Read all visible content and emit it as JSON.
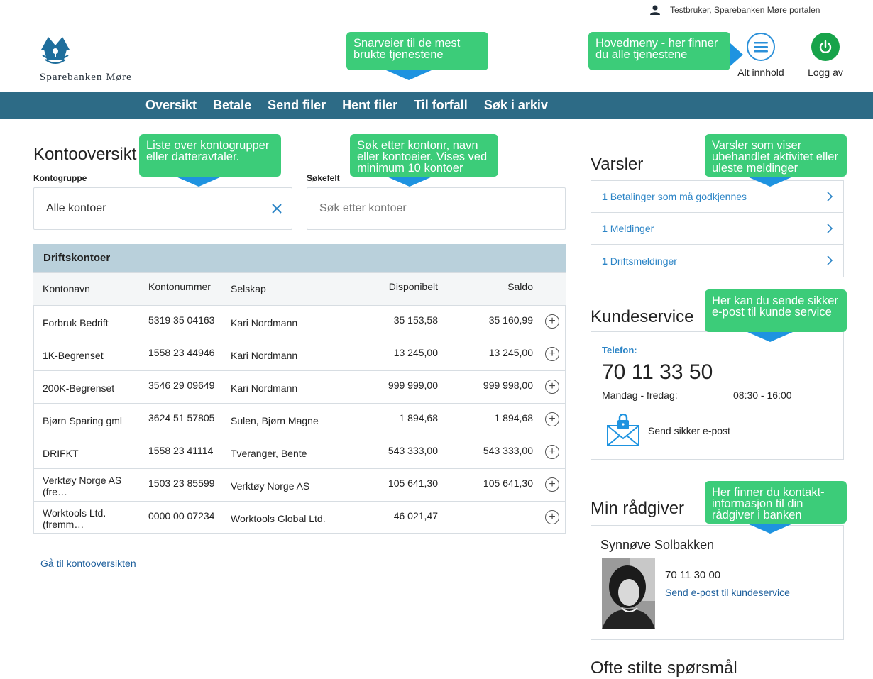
{
  "user": {
    "name": "Testbruker, Sparebanken Møre portalen"
  },
  "logo": {
    "text": "Sparebanken Møre"
  },
  "header": {
    "menu_label": "Alt innhold",
    "logout_label": "Logg av"
  },
  "nav": [
    "Oversikt",
    "Betale",
    "Send filer",
    "Hent filer",
    "Til forfall",
    "Søk i arkiv"
  ],
  "callouts": {
    "shortcuts": "Snarveier til de mest brukte tjenestene",
    "mainmenu": "Hovedmeny - her finner du alle tjenestene",
    "groups": "Liste over kontogrupper eller datteravtaler.",
    "search": "Søk etter kontonr, navn eller kontoeier. Vises ved minimum 10 kontoer",
    "alerts": "Varsler som viser ubehandlet aktivitet eller uleste meldinger",
    "service": "Her kan du sende sikker e-post til kunde service",
    "advisor": "Her finner du kontakt-informasjon til din rådgiver i banken"
  },
  "overview": {
    "title": "Kontooversikt",
    "group_label": "Kontogruppe",
    "group_value": "Alle kontoer",
    "search_label": "Søkefelt",
    "search_placeholder": "Søk etter kontoer",
    "group_name": "Driftskontoer",
    "columns": [
      "Kontonavn",
      "Kontonummer",
      "Selskap",
      "Disponibelt",
      "Saldo"
    ],
    "rows": [
      [
        "Forbruk Bedrift",
        "5319 35 04163",
        "Kari Nordmann",
        "35 153,58",
        "35 160,99"
      ],
      [
        "1K-Begrenset",
        "1558 23 44946",
        "Kari Nordmann",
        "13 245,00",
        "13 245,00"
      ],
      [
        "200K-Begrenset",
        "3546 29 09649",
        "Kari Nordmann",
        "999 999,00",
        "999 998,00"
      ],
      [
        "Bjørn Sparing gml",
        "3624 51 57805",
        "Sulen, Bjørn Magne",
        "1 894,68",
        "1 894,68"
      ],
      [
        "DRIFKT",
        "1558 23 41114",
        "Tveranger, Bente",
        "543 333,00",
        "543 333,00"
      ],
      [
        "Verktøy Norge AS (fre…",
        "1503 23 85599",
        "Verktøy Norge AS",
        "105 641,30",
        "105 641,30"
      ],
      [
        "Worktools Ltd. (fremm…",
        "0000 00 07234",
        "Worktools Global Ltd.",
        "46 021,47",
        ""
      ]
    ],
    "link": "Gå til kontooversikten"
  },
  "alerts": {
    "title": "Varsler",
    "items": [
      {
        "count": "1",
        "label": "Betalinger som må godkjennes"
      },
      {
        "count": "1",
        "label": "Meldinger"
      },
      {
        "count": "1",
        "label": "Driftsmeldinger"
      }
    ]
  },
  "service": {
    "title": "Kundeservice",
    "phone_label": "Telefon:",
    "phone": "70 11 33 50",
    "days": "Mandag - fredag:",
    "hours": "08:30 - 16:00",
    "email_label": "Send sikker e-post"
  },
  "advisor": {
    "title": "Min rådgiver",
    "name": "Synnøve Solbakken",
    "phone": "70 11 30 00",
    "email_link": "Send e-post til kundeservice"
  },
  "faq": {
    "title": "Ofte stilte spørsmål"
  },
  "colors": {
    "nav": "#2d6b86",
    "callout": "#3ccc79",
    "arrow": "#1e93e0",
    "link": "#2b84c6",
    "power": "#17a34a"
  }
}
